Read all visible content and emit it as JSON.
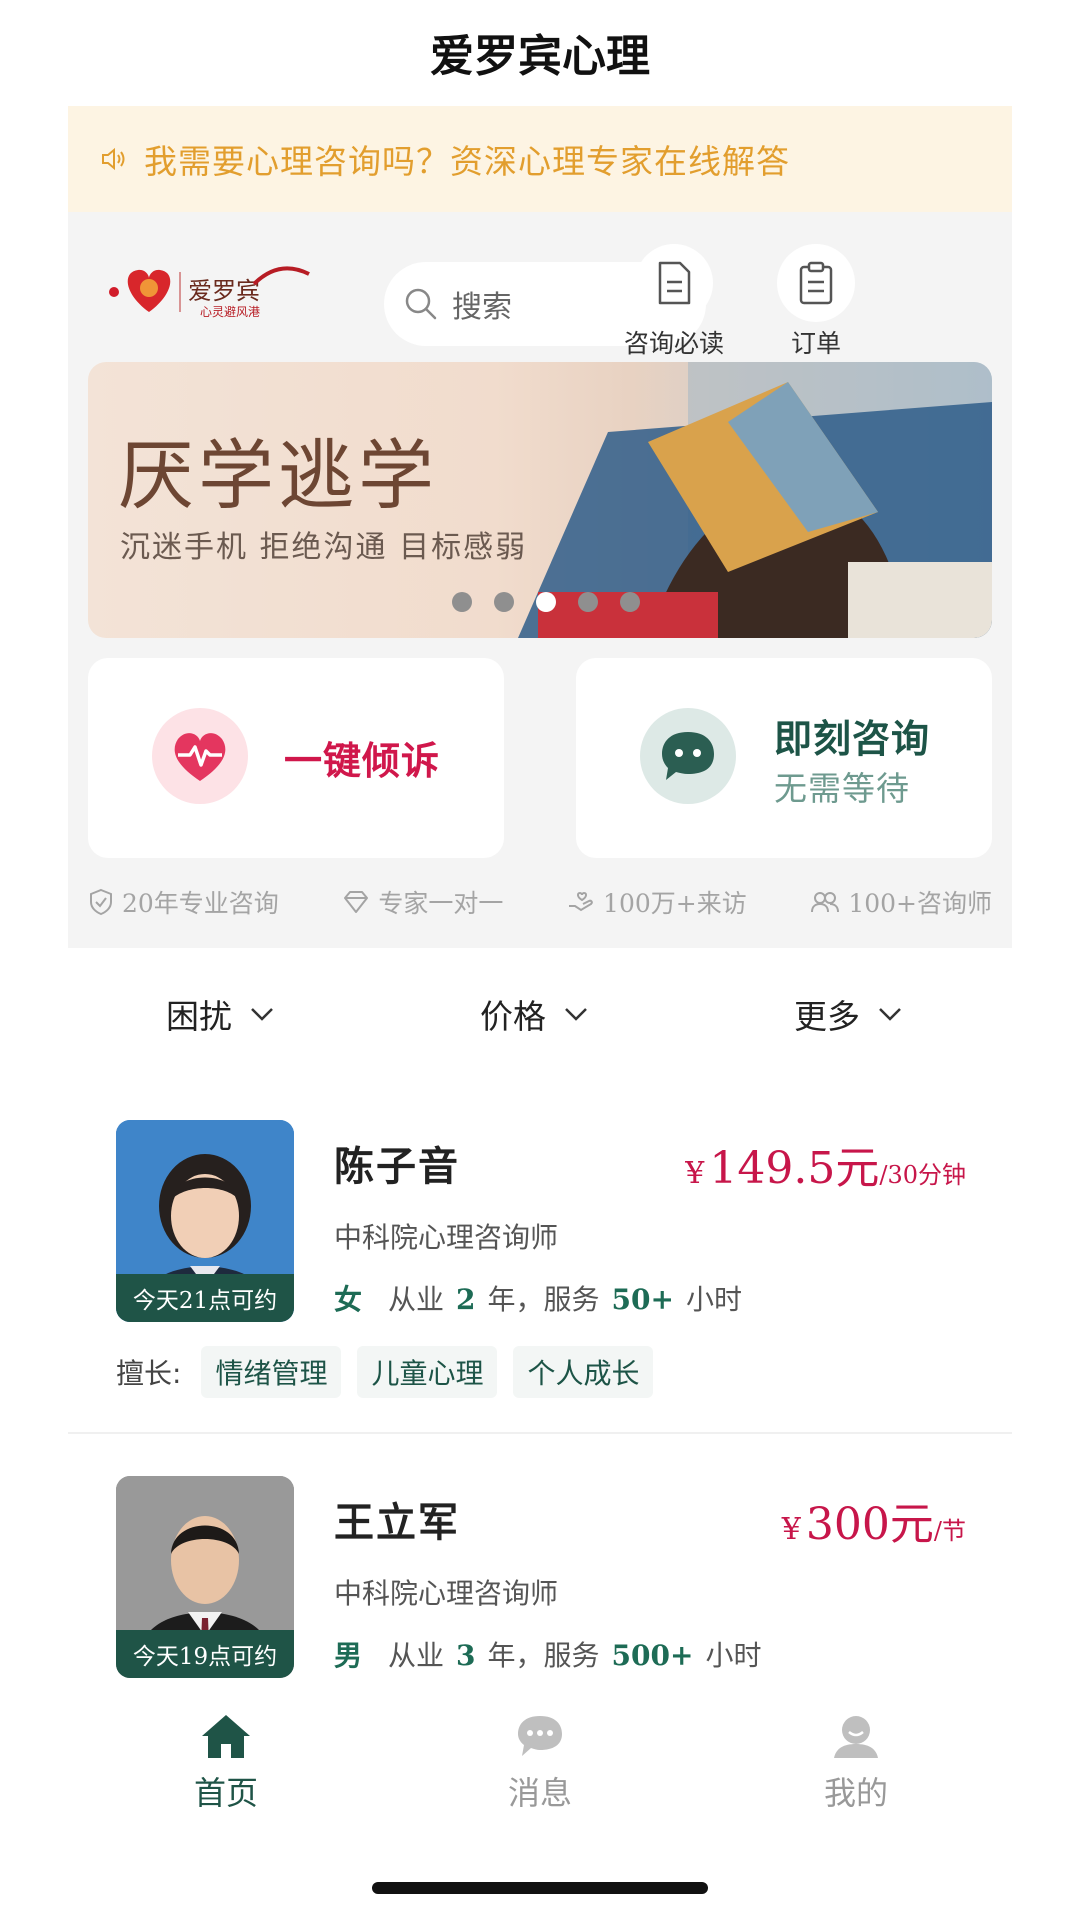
{
  "app": {
    "title": "爱罗宾心理"
  },
  "notice": {
    "text": "我需要心理咨询吗？资深心理专家在线解答",
    "icon": "speaker-icon"
  },
  "header": {
    "logo": {
      "text": "爱罗宾",
      "subtitle": "心灵避风港",
      "icon": "heart-logo"
    },
    "search": {
      "placeholder": "搜索"
    },
    "quick_links": [
      {
        "label": "咨询必读",
        "icon": "document-icon"
      },
      {
        "label": "订单",
        "icon": "clipboard-icon"
      }
    ]
  },
  "banner": {
    "title": "厌学逃学",
    "subtitle": "沉迷手机 拒绝沟通 目标感弱",
    "slide_count": 5,
    "active_slide": 3
  },
  "actions": [
    {
      "label": "一键倾诉",
      "icon": "heart-pulse-icon"
    },
    {
      "label": "即刻咨询",
      "sublabel": "无需等待",
      "icon": "chat-bubble-icon"
    }
  ],
  "features": [
    {
      "label": "20年专业咨询",
      "icon": "shield-icon"
    },
    {
      "label": "专家一对一",
      "icon": "diamond-icon"
    },
    {
      "label": "100万+来访",
      "icon": "hand-heart-icon"
    },
    {
      "label": "100+咨询师",
      "icon": "users-icon"
    }
  ],
  "filters": [
    {
      "label": "困扰"
    },
    {
      "label": "价格"
    },
    {
      "label": "更多"
    }
  ],
  "counselors": [
    {
      "name": "陈子音",
      "availability": "今天21点可约",
      "currency": "¥",
      "price": "149.5元",
      "unit": "/30分钟",
      "title": "中科院心理咨询师",
      "gender": "女",
      "years_prefix": "从业",
      "years": "2",
      "years_suffix": "年，服务",
      "hours": "50+",
      "hours_suffix": "小时",
      "specialty_label": "擅长:",
      "tags": [
        "情绪管理",
        "儿童心理",
        "个人成长"
      ]
    },
    {
      "name": "王立军",
      "availability": "今天19点可约",
      "currency": "¥",
      "price": "300元",
      "unit": "/节",
      "title": "中科院心理咨询师",
      "gender": "男",
      "years_prefix": "从业",
      "years": "3",
      "years_suffix": "年，服务",
      "hours": "500+",
      "hours_suffix": "小时"
    }
  ],
  "tabbar": [
    {
      "label": "首页",
      "icon": "home-icon",
      "active": true
    },
    {
      "label": "消息",
      "icon": "message-icon",
      "active": false
    },
    {
      "label": "我的",
      "icon": "profile-icon",
      "active": false
    }
  ],
  "colors": {
    "primary_green": "#1f5447",
    "accent_red": "#c7164a",
    "notice_orange": "#e29e2e"
  }
}
